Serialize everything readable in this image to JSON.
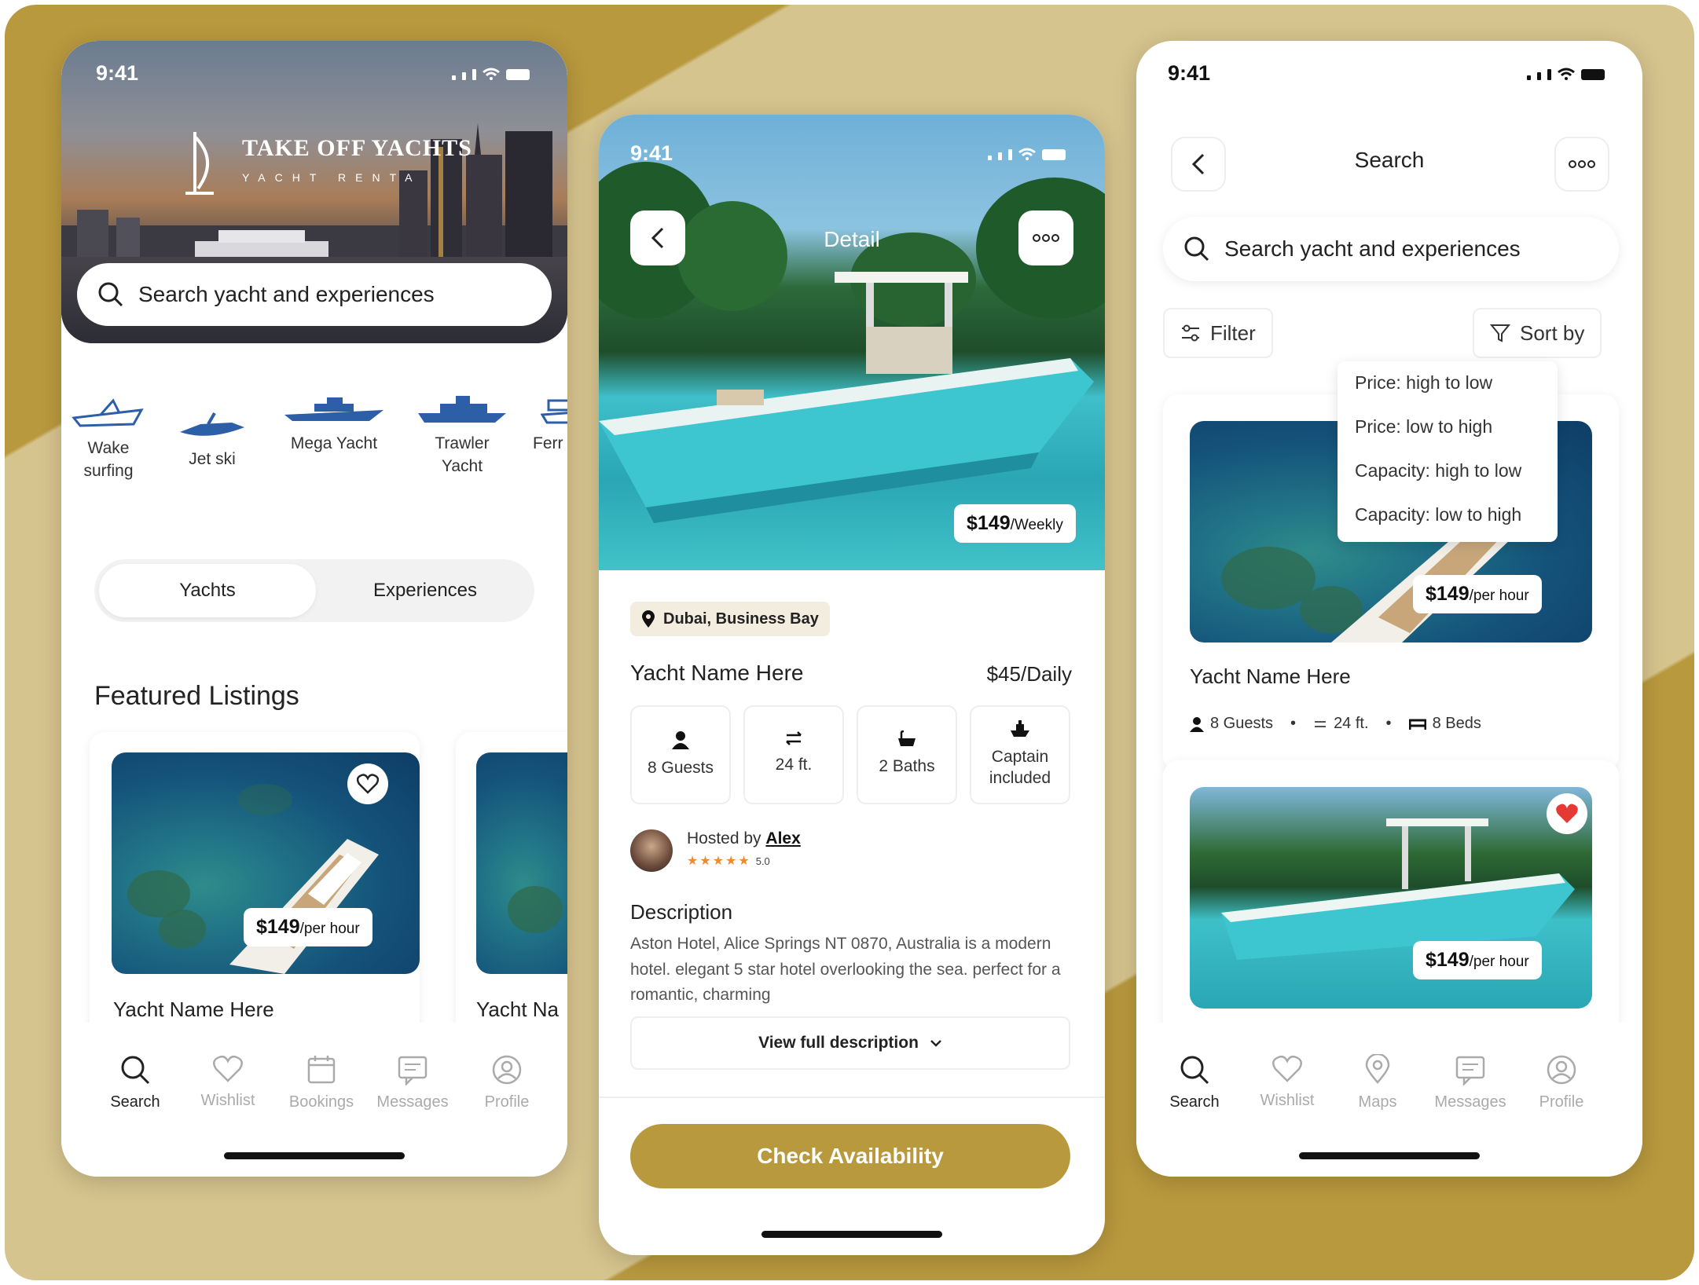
{
  "phone1": {
    "status_time": "9:41",
    "brand_name": "TAKE OFF YACHTS",
    "brand_tagline": "YACHT RENTA",
    "search_placeholder": "Search yacht and experiences",
    "categories": [
      {
        "label": "Wake surfing",
        "icon": "wake-surf-boat-icon"
      },
      {
        "label": "Jet ski",
        "icon": "jet-ski-icon"
      },
      {
        "label": "Mega Yacht",
        "icon": "mega-yacht-icon"
      },
      {
        "label": "Trawler Yacht",
        "icon": "trawler-yacht-icon"
      },
      {
        "label": "Ferr Cru",
        "icon": "ferry-cruise-icon"
      }
    ],
    "segment": {
      "active": "Yachts",
      "inactive": "Experiences"
    },
    "featured_title": "Featured Listings",
    "listings": [
      {
        "price": "$149",
        "unit": "/per hour",
        "name": "Yacht Name Here"
      },
      {
        "name": "Yacht Na"
      }
    ],
    "tabs": [
      {
        "label": "Search",
        "icon": "search-icon",
        "active": true
      },
      {
        "label": "Wishlist",
        "icon": "heart-icon"
      },
      {
        "label": "Bookings",
        "icon": "calendar-icon"
      },
      {
        "label": "Messages",
        "icon": "message-icon"
      },
      {
        "label": "Profile",
        "icon": "profile-icon"
      }
    ]
  },
  "phone2": {
    "status_time": "9:41",
    "title": "Detail",
    "hero_price": "$149",
    "hero_unit": "/Weekly",
    "location": "Dubai, Business Bay",
    "yacht_name": "Yacht Name Here",
    "daily_price": "$45/Daily",
    "specs": [
      {
        "label": "8 Guests",
        "icon": "person-icon"
      },
      {
        "label": "24 ft.",
        "icon": "ruler-icon"
      },
      {
        "label": "2 Baths",
        "icon": "bathtub-icon"
      },
      {
        "label": "Captain included",
        "icon": "captain-boat-icon"
      }
    ],
    "host_prefix": "Hosted by",
    "host_name": "Alex",
    "rating": "5.0",
    "description_title": "Description",
    "description_text": "Aston Hotel, Alice Springs NT 0870, Australia is a modern hotel. elegant 5 star hotel overlooking the sea. perfect for a romantic, charming",
    "view_full": "View full description",
    "cta": "Check Availability",
    "accent": "#b9993e"
  },
  "phone3": {
    "status_time": "9:41",
    "title": "Search",
    "search_placeholder": "Search yacht and experiences",
    "filter": "Filter",
    "sort": "Sort by",
    "sort_options": [
      "Price: high to low",
      "Price: low to high",
      "Capacity: high to low",
      "Capacity: low to high"
    ],
    "listings": [
      {
        "price": "$149",
        "unit": "/per hour",
        "name": "Yacht Name Here",
        "guests": "8 Guests",
        "length": "24 ft.",
        "beds": "8 Beds"
      },
      {
        "price": "$149",
        "unit": "/per hour"
      }
    ],
    "tabs": [
      {
        "label": "Search",
        "icon": "search-icon",
        "active": true
      },
      {
        "label": "Wishlist",
        "icon": "heart-icon"
      },
      {
        "label": "Maps",
        "icon": "map-pin-icon"
      },
      {
        "label": "Messages",
        "icon": "message-icon"
      },
      {
        "label": "Profile",
        "icon": "profile-icon"
      }
    ]
  }
}
